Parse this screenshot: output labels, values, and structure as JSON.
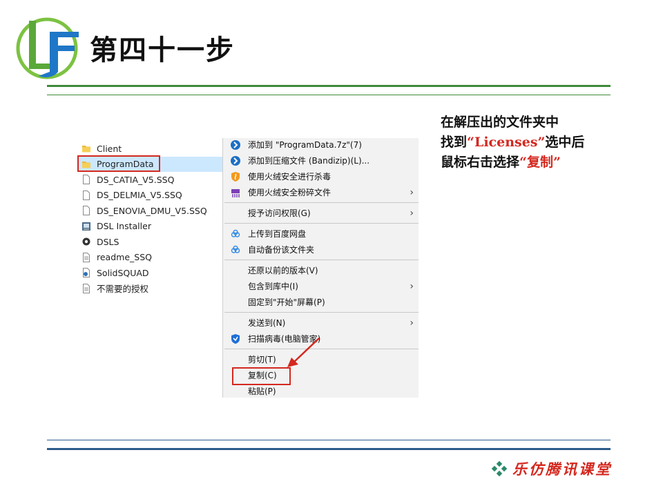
{
  "slide": {
    "title": "第四十一步",
    "instruction": {
      "line1": "在解压出的文件夹中",
      "line2_pre": "找到",
      "line2_quote_open": "“",
      "line2_highlight": "Licenses",
      "line2_quote_close": "”",
      "line2_post": "选中后",
      "line3_pre": "鼠标右击选择",
      "line3_quote_open": "“",
      "line3_highlight": "复制",
      "line3_quote_close": "”"
    },
    "footer_brand": "乐仿腾讯课堂"
  },
  "colors": {
    "accent_red": "#d4281f",
    "rule_green": "#3d8a3a",
    "rule_blue": "#2b5c8a",
    "selection": "#cce8ff"
  },
  "files": [
    {
      "name": "Client",
      "icon": "folder-icon"
    },
    {
      "name": "ProgramData",
      "icon": "folder-icon"
    },
    {
      "name": "DS_CATIA_V5.SSQ",
      "icon": "file-icon"
    },
    {
      "name": "DS_DELMIA_V5.SSQ",
      "icon": "file-icon"
    },
    {
      "name": "DS_ENOVIA_DMU_V5.SSQ",
      "icon": "file-icon"
    },
    {
      "name": "DSL Installer",
      "icon": "installer-icon"
    },
    {
      "name": "DSLS",
      "icon": "gear-icon"
    },
    {
      "name": "readme_SSQ",
      "icon": "text-file-icon"
    },
    {
      "name": "SolidSQUAD",
      "icon": "script-icon"
    },
    {
      "name": "不需要的授权",
      "icon": "text-file-icon"
    }
  ],
  "menu": {
    "add_to_7z": "添加到 \"ProgramData.7z\"(7)",
    "add_to_archive": "添加到压缩文件 (Bandizip)(L)...",
    "huorong_scan": "使用火绒安全进行杀毒",
    "huorong_shred": "使用火绒安全粉碎文件",
    "grant_access": "授予访问权限(G)",
    "upload_baidu": "上传到百度网盘",
    "auto_backup": "自动备份该文件夹",
    "restore_versions": "还原以前的版本(V)",
    "include_library": "包含到库中(I)",
    "pin_start": "固定到\"开始\"屏幕(P)",
    "send_to": "发送到(N)",
    "scan_virus": "扫描病毒(电脑管家)",
    "cut": "剪切(T)",
    "copy": "复制(C)",
    "paste": "粘贴(P)"
  }
}
